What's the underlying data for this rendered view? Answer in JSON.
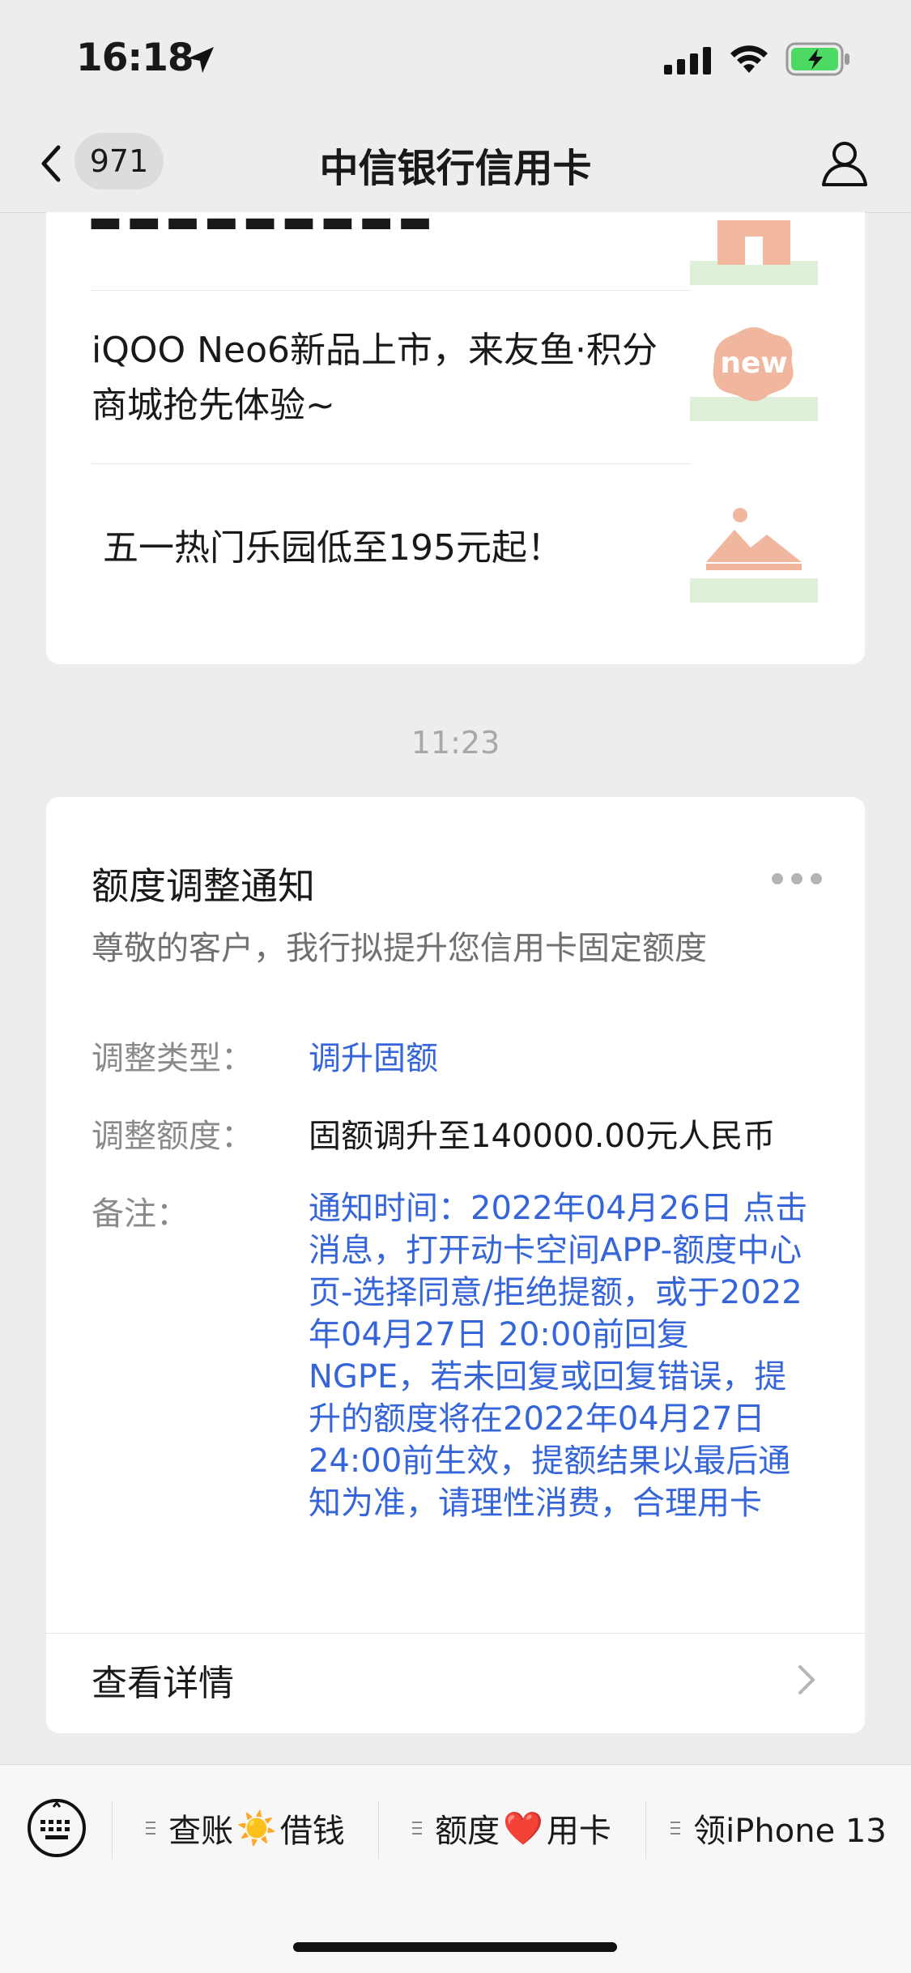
{
  "status": {
    "time": "16:18"
  },
  "nav": {
    "back_count": "971",
    "title": "中信银行信用卡"
  },
  "articles": [
    {
      "title": "iQOO Neo6新品上市，来友鱼·积分商城抢先体验~"
    },
    {
      "title": "五一热门乐园低至195元起！"
    }
  ],
  "thumb_new_text": "new",
  "timestamp": "11:23",
  "notice": {
    "title": "额度调整通知",
    "subtitle": "尊敬的客户，我行拟提升您信用卡固定额度",
    "type_label": "调整类型：",
    "type_value": "调升固额",
    "amount_label": "调整额度：",
    "amount_value": "固额调升至140000.00元人民币",
    "remark_label": "备注：",
    "remark_value": "通知时间：2022年04月26日 点击消息，打开动卡空间APP-额度中心页-选择同意/拒绝提额，或于2022年04月27日 20:00前回复NGPE，若未回复或回复错误，提升的额度将在2022年04月27日24:00前生效，提额结果以最后通知为准，请理性消费，合理用卡",
    "details_label": "查看详情"
  },
  "menu": {
    "item1_a": "查账",
    "item1_emoji": "☀️",
    "item1_b": "借钱",
    "item2_a": "额度",
    "item2_emoji": "❤️",
    "item2_b": "用卡",
    "item3": "领iPhone 13"
  }
}
